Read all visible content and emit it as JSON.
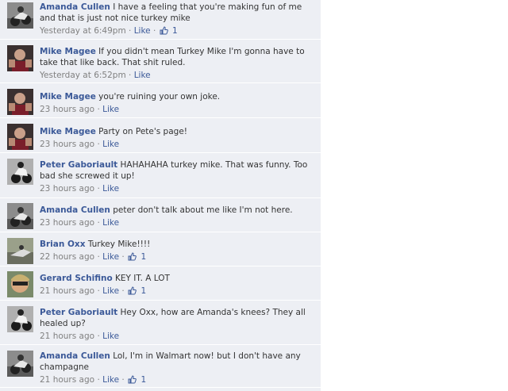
{
  "colors": {
    "link": "#3b5998",
    "background": "#edeff4",
    "meta": "#808080",
    "text": "#333333"
  },
  "comments": [
    {
      "author": "Amanda Cullen",
      "text": "I have a feeling that you're making fun of me and that is just not nice turkey mike",
      "time": "Yesterday at 6:49pm",
      "like_label": "Like",
      "like_count": "1",
      "avatar": "amanda"
    },
    {
      "author": "Mike Magee",
      "text": "If you didn't mean Turkey Mike I'm gonna have to take that like back. That shit ruled.",
      "time": "Yesterday at 6:52pm",
      "like_label": "Like",
      "avatar": "mike"
    },
    {
      "author": "Mike Magee",
      "text": "you're ruining your own joke.",
      "time": "23 hours ago",
      "like_label": "Like",
      "avatar": "mike"
    },
    {
      "author": "Mike Magee",
      "text": "Party on Pete's page!",
      "time": "23 hours ago",
      "like_label": "Like",
      "avatar": "mike"
    },
    {
      "author": "Peter Gaboriault",
      "text": "HAHAHAHA turkey mike. That was funny. Too bad she screwed it up!",
      "time": "23 hours ago",
      "like_label": "Like",
      "avatar": "peter"
    },
    {
      "author": "Amanda Cullen",
      "text": "peter don't talk about me like I'm not here.",
      "time": "23 hours ago",
      "like_label": "Like",
      "avatar": "amanda"
    },
    {
      "author": "Brian Oxx",
      "text": "Turkey Mike!!!!",
      "time": "22 hours ago",
      "like_label": "Like",
      "like_count": "1",
      "avatar": "brian"
    },
    {
      "author": "Gerard Schifino",
      "text": "KEY IT. A LOT",
      "time": "21 hours ago",
      "like_label": "Like",
      "like_count": "1",
      "avatar": "gerard"
    },
    {
      "author": "Peter Gaboriault",
      "text": "Hey Oxx, how are Amanda's knees? They all healed up?",
      "time": "21 hours ago",
      "like_label": "Like",
      "avatar": "peter"
    },
    {
      "author": "Amanda Cullen",
      "text": "Lol, I'm in Walmart now! but I don't have any champagne",
      "time": "21 hours ago",
      "like_label": "Like",
      "like_count": "1",
      "avatar": "amanda"
    }
  ]
}
